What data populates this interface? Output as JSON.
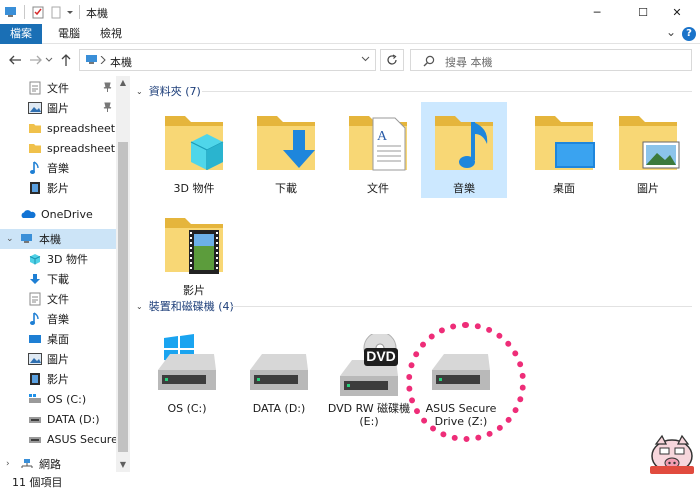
{
  "window": {
    "title": "本機",
    "minimize": "─",
    "maximize": "☐",
    "close": "✕"
  },
  "ribbon": {
    "tabs": [
      "檔案",
      "電腦",
      "檢視"
    ],
    "collapse": "⌄",
    "help": "?"
  },
  "address": {
    "path": "本機",
    "search_placeholder": "搜尋 本機"
  },
  "sidebar": {
    "quick_items": [
      {
        "label": "文件",
        "pinned": true
      },
      {
        "label": "圖片",
        "pinned": true
      },
      {
        "label": "spreadsheet"
      },
      {
        "label": "spreadsheet"
      },
      {
        "label": "音樂"
      },
      {
        "label": "影片"
      }
    ],
    "onedrive": "OneDrive",
    "thispc": "本機",
    "pc_items": [
      "3D 物件",
      "下載",
      "文件",
      "音樂",
      "桌面",
      "圖片",
      "影片",
      "OS (C:)",
      "DATA (D:)",
      "ASUS Secure Drive (Z:)"
    ],
    "network": "網路"
  },
  "main": {
    "folders_header": "資料夾 (7)",
    "folders": [
      "3D 物件",
      "下載",
      "文件",
      "音樂",
      "桌面",
      "圖片",
      "影片"
    ],
    "drives_header": "裝置和磁碟機 (4)",
    "drives": [
      {
        "line1": "OS (C:)",
        "line2": ""
      },
      {
        "line1": "DATA (D:)",
        "line2": ""
      },
      {
        "line1": "DVD RW 磁碟機",
        "line2": "(E:)"
      },
      {
        "line1": "ASUS Secure",
        "line2": "Drive (Z:)"
      }
    ],
    "dvd_badge": "DVD"
  },
  "status": {
    "count": "11 個項目"
  },
  "colors": {
    "accent": "#1a6fb5",
    "selection": "#cce8ff",
    "folder": "#f3c94f",
    "annotation": "#ee2d78"
  }
}
